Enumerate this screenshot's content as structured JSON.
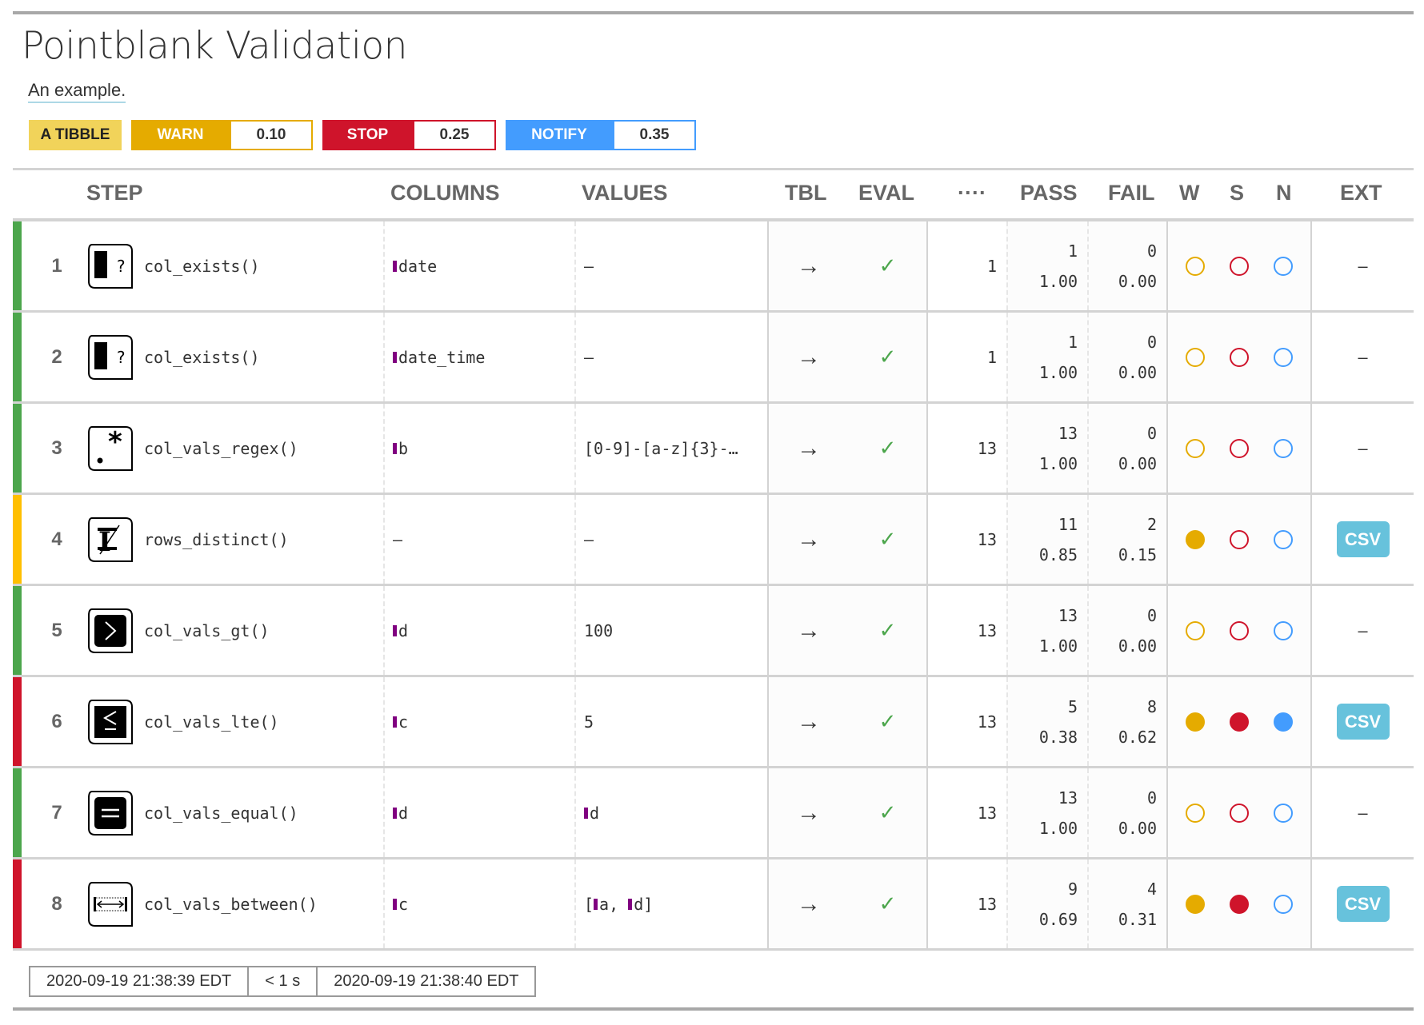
{
  "title": "Pointblank Validation",
  "subtitle": "An example.",
  "badges": {
    "tbl": "A TIBBLE",
    "warn_label": "WARN",
    "warn_value": "0.10",
    "stop_label": "STOP",
    "stop_value": "0.25",
    "notify_label": "NOTIFY",
    "notify_value": "0.35"
  },
  "colors": {
    "warn": "#E5AB00",
    "stop": "#CF142B",
    "notify": "#439CFE",
    "tbl": "#F1D35A",
    "pass": "#4CA64C",
    "warn_bar": "#FFBF00",
    "csv": "#67C2DC"
  },
  "headers": {
    "step": "STEP",
    "columns": "COLUMNS",
    "values": "VALUES",
    "tbl": "TBL",
    "eval": "EVAL",
    "units": "····",
    "pass": "PASS",
    "fail": "FAIL",
    "w": "W",
    "s": "S",
    "n": "N",
    "ext": "EXT"
  },
  "rows": [
    {
      "step": "1",
      "icon": "col-exists",
      "fn": "col_exists()",
      "column": "date",
      "values": "—",
      "tbl": "→",
      "eval": "✓",
      "units": "1",
      "pass_n": "1",
      "pass_f": "1.00",
      "fail_n": "0",
      "fail_f": "0.00",
      "w": false,
      "s": false,
      "n": false,
      "ext": "—",
      "status": "pass"
    },
    {
      "step": "2",
      "icon": "col-exists",
      "fn": "col_exists()",
      "column": "date_time",
      "values": "—",
      "tbl": "→",
      "eval": "✓",
      "units": "1",
      "pass_n": "1",
      "pass_f": "1.00",
      "fail_n": "0",
      "fail_f": "0.00",
      "w": false,
      "s": false,
      "n": false,
      "ext": "—",
      "status": "pass"
    },
    {
      "step": "3",
      "icon": "regex",
      "fn": "col_vals_regex()",
      "column": "b",
      "values": "[0-9]-[a-z]{3}-…",
      "tbl": "→",
      "eval": "✓",
      "units": "13",
      "pass_n": "13",
      "pass_f": "1.00",
      "fail_n": "0",
      "fail_f": "0.00",
      "w": false,
      "s": false,
      "n": false,
      "ext": "—",
      "status": "pass"
    },
    {
      "step": "4",
      "icon": "distinct",
      "fn": "rows_distinct()",
      "column": "—",
      "values": "—",
      "tbl": "→",
      "eval": "✓",
      "units": "13",
      "pass_n": "11",
      "pass_f": "0.85",
      "fail_n": "2",
      "fail_f": "0.15",
      "w": true,
      "s": false,
      "n": false,
      "ext": "CSV",
      "status": "warn"
    },
    {
      "step": "5",
      "icon": "gt",
      "fn": "col_vals_gt()",
      "column": "d",
      "values": "100",
      "tbl": "→",
      "eval": "✓",
      "units": "13",
      "pass_n": "13",
      "pass_f": "1.00",
      "fail_n": "0",
      "fail_f": "0.00",
      "w": false,
      "s": false,
      "n": false,
      "ext": "—",
      "status": "pass"
    },
    {
      "step": "6",
      "icon": "lte",
      "fn": "col_vals_lte()",
      "column": "c",
      "values": "5",
      "tbl": "→",
      "eval": "✓",
      "units": "13",
      "pass_n": "5",
      "pass_f": "0.38",
      "fail_n": "8",
      "fail_f": "0.62",
      "w": true,
      "s": true,
      "n": true,
      "ext": "CSV",
      "status": "stop"
    },
    {
      "step": "7",
      "icon": "equal",
      "fn": "col_vals_equal()",
      "column": "d",
      "value_cols": [
        "d"
      ],
      "tbl": "→",
      "eval": "✓",
      "units": "13",
      "pass_n": "13",
      "pass_f": "1.00",
      "fail_n": "0",
      "fail_f": "0.00",
      "w": false,
      "s": false,
      "n": false,
      "ext": "—",
      "status": "pass"
    },
    {
      "step": "8",
      "icon": "between",
      "fn": "col_vals_between()",
      "column": "c",
      "value_cols": [
        "a",
        "d"
      ],
      "tbl": "→",
      "eval": "✓",
      "units": "13",
      "pass_n": "9",
      "pass_f": "0.69",
      "fail_n": "4",
      "fail_f": "0.31",
      "w": true,
      "s": true,
      "n": false,
      "ext": "CSV",
      "status": "stop"
    }
  ],
  "footer": {
    "start": "2020-09-19 21:38:39 EDT",
    "duration": "< 1 s",
    "end": "2020-09-19 21:38:40 EDT"
  }
}
